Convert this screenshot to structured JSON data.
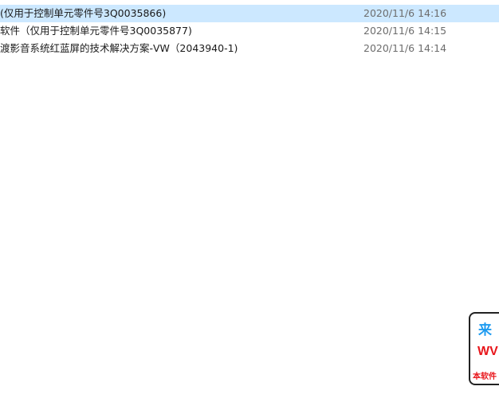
{
  "files": [
    {
      "name": "(仅用于控制单元零件号3Q0035866)",
      "modified": "2020/11/6 14:16",
      "selected": true
    },
    {
      "name": "软件（仅用于控制单元零件号3Q0035877)",
      "modified": "2020/11/6 14:15",
      "selected": false
    },
    {
      "name": "渡影音系统红蓝屏的技术解决方案-VW（2043940-1)",
      "modified": "2020/11/6 14:14",
      "selected": false
    }
  ],
  "watermark": {
    "line1": "来",
    "line2": "WV",
    "line3": "本软件"
  },
  "colors": {
    "selected_row": "#cce8ff",
    "date_text": "#6d6d6d",
    "watermark_blue": "#1e9bf0",
    "watermark_red": "#e8161b"
  }
}
